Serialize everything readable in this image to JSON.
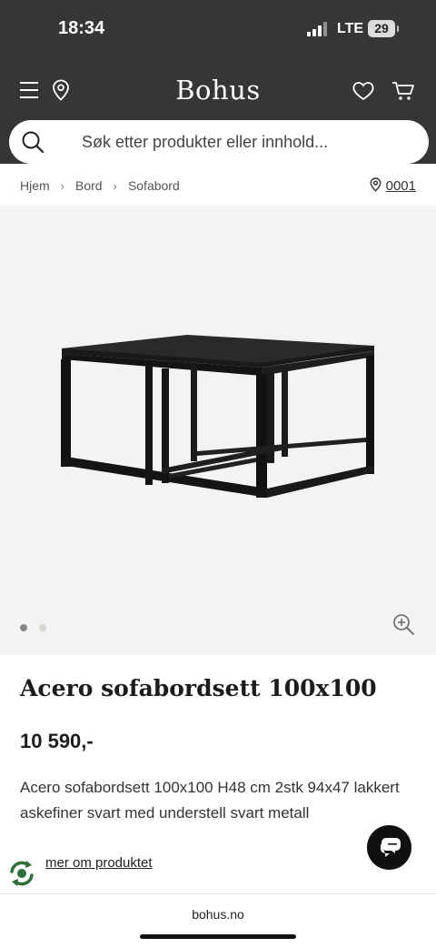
{
  "status_bar": {
    "time": "18:34",
    "network": "LTE",
    "battery": "29"
  },
  "header": {
    "logo": "Bohus",
    "icons": [
      "menu-icon",
      "location-pin-icon",
      "heart-icon",
      "cart-icon"
    ],
    "background_color": "#363636"
  },
  "search": {
    "placeholder": "Søk etter produkter eller innhold..."
  },
  "breadcrumb": {
    "items": [
      "Hjem",
      "Bord",
      "Sofabord"
    ],
    "store_code": "0001"
  },
  "gallery": {
    "image_count": 2,
    "active_index": 0
  },
  "product": {
    "title": "Acero sofabordsett 100x100",
    "price": "10 590,-",
    "description": "Acero sofabordsett 100x100 H48 cm 2stk 94x47 lakkert askefiner svart med understell svart metall",
    "more_link": "mer om produktet"
  },
  "browser": {
    "url": "bohus.no"
  }
}
